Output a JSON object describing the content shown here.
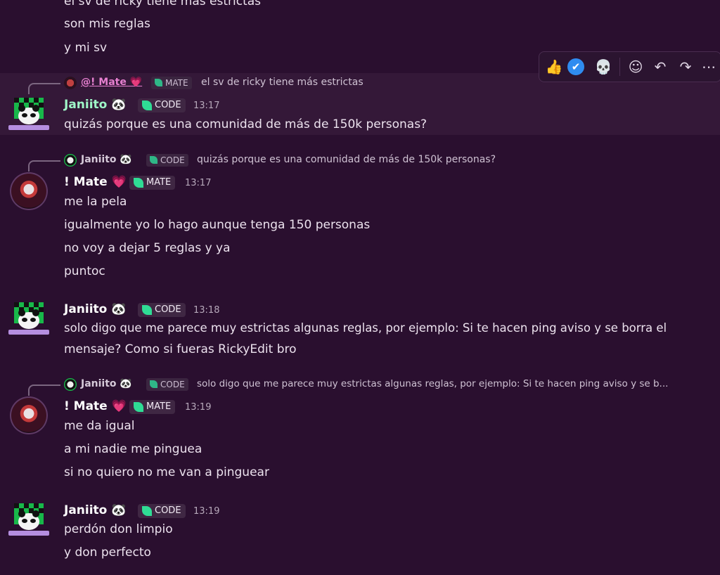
{
  "colors": {
    "background": "#2a0f2f",
    "highlight": "#341838",
    "code_badge_leaf": "#2fdc95",
    "janiito_name": "#9ff7c8",
    "mention": "#e680d0"
  },
  "top_lines": [
    "el sv de ricky tiene más estrictas",
    "son mis reglas",
    "y mi sv"
  ],
  "toolbar": {
    "icons": [
      "thumbs-up-icon",
      "verified-check-icon",
      "skull-icon",
      "add-reaction-icon",
      "reply-icon",
      "forward-icon",
      "more-icon"
    ],
    "glyphs": [
      "👍",
      "✔",
      "💀",
      "☺",
      "↶",
      "↷",
      "⋯"
    ]
  },
  "messages": [
    {
      "reply": {
        "mention": "@! Mate 💗",
        "badge": "MATE",
        "text": "el sv de ricky tiene más estrictas"
      },
      "author": "Janiito 🐼",
      "badge": "CODE",
      "time": "13:17",
      "lines": [
        "quizás porque es una comunidad de más de 150k personas?"
      ]
    },
    {
      "reply": {
        "author": "Janiito 🐼",
        "badge": "CODE",
        "text": "quizás porque es una comunidad de más de 150k personas?"
      },
      "author": "! Mate 💗",
      "badge": "MATE",
      "time": "13:17",
      "lines": [
        "me la pela",
        "igualmente yo lo hago aunque tenga 150 personas",
        "no voy a dejar 5 reglas y ya",
        "puntoc"
      ]
    },
    {
      "author": "Janiito 🐼",
      "badge": "CODE",
      "time": "13:18",
      "lines": [
        "solo digo que me parece muy estrictas algunas reglas, por ejemplo: Si te hacen ping aviso y se borra el",
        "mensaje? Como si fueras RickyEdit bro"
      ]
    },
    {
      "reply": {
        "author": "Janiito 🐼",
        "badge": "CODE",
        "text": "solo digo que me parece muy estrictas algunas reglas, por ejemplo: Si te hacen ping aviso y se b..."
      },
      "author": "! Mate 💗",
      "badge": "MATE",
      "time": "13:19",
      "lines": [
        "me da igual",
        "a mi nadie me pinguea",
        "si no quiero no me van a pinguear"
      ]
    },
    {
      "author": "Janiito 🐼",
      "badge": "CODE",
      "time": "13:19",
      "lines": [
        "perdón don limpio",
        "y don perfecto"
      ]
    }
  ]
}
